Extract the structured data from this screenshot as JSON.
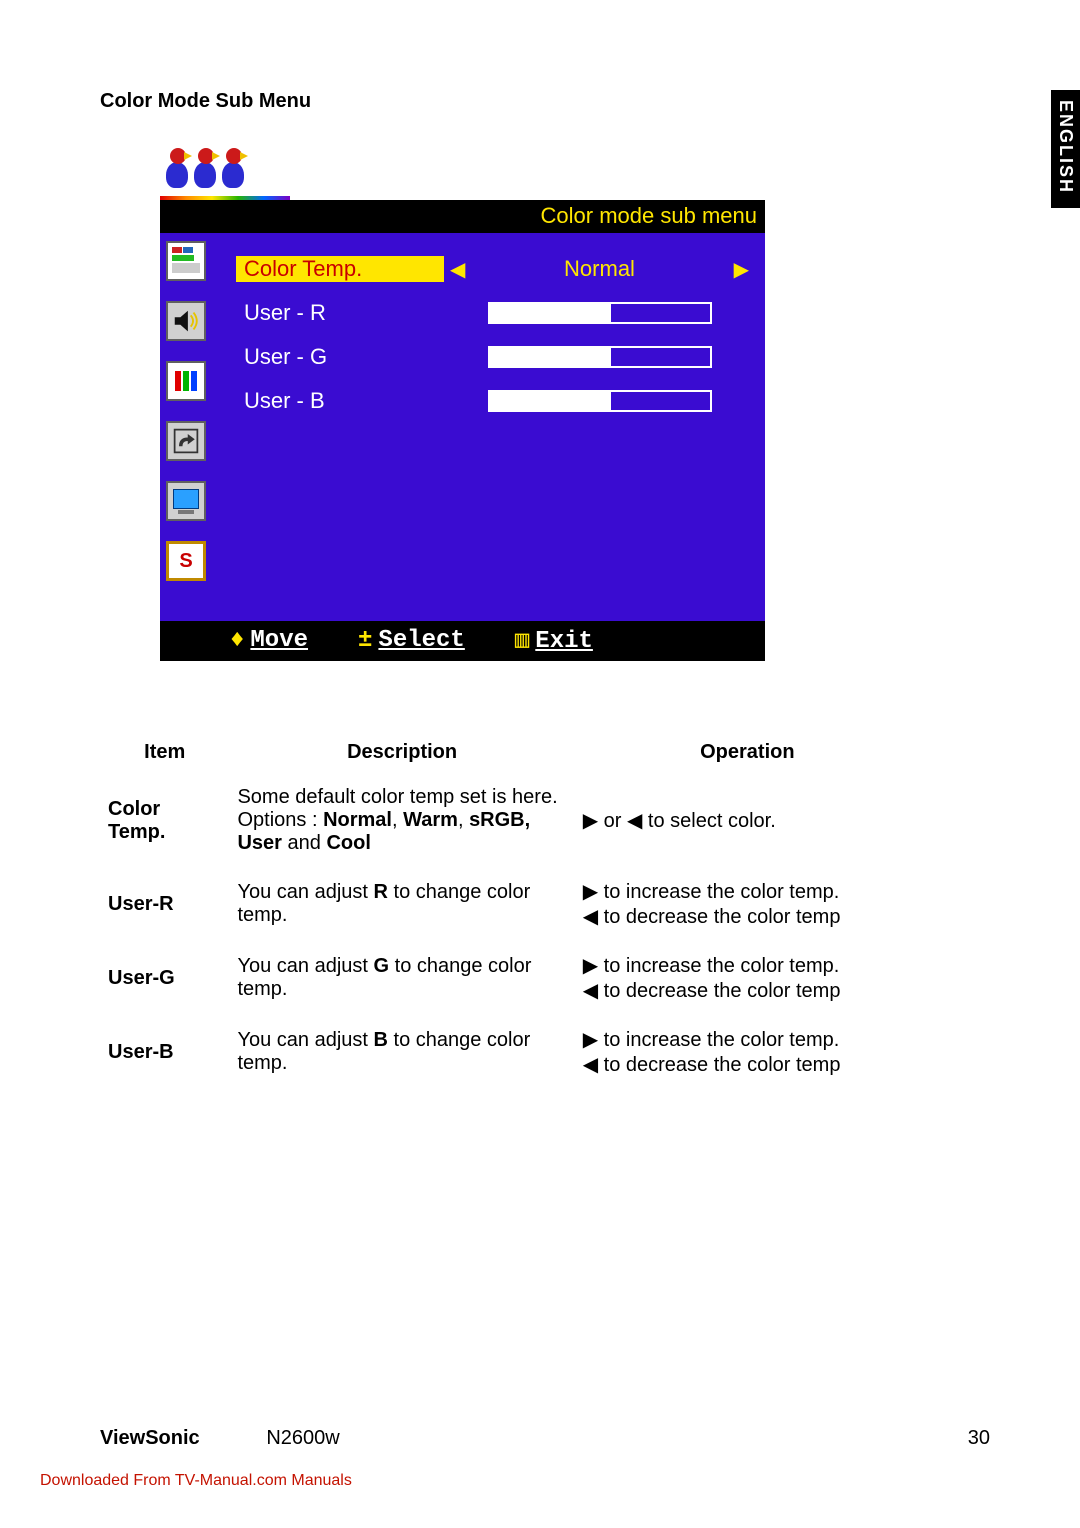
{
  "language_tab": "ENGLISH",
  "section_title": "Color Mode Sub Menu",
  "osd": {
    "title": "Color mode sub menu",
    "rows": {
      "color_temp": {
        "label": "Color Temp.",
        "value": "Normal"
      },
      "user_r": {
        "label": "User - R"
      },
      "user_g": {
        "label": "User - G"
      },
      "user_b": {
        "label": "User - B"
      }
    },
    "footer": {
      "move": "Move",
      "select": "Select",
      "exit": "Exit"
    }
  },
  "table": {
    "headers": {
      "item": "Item",
      "description": "Description",
      "operation": "Operation"
    },
    "rows": [
      {
        "item": "Color Temp.",
        "desc_pre": "Some default color temp set is here. Options : ",
        "desc_bold1": "Normal",
        "desc_sep1": ", ",
        "desc_bold2": "Warm",
        "desc_sep2": ", ",
        "desc_bold3": "sRGB, User",
        "desc_sep3": " and ",
        "desc_bold4": "Cool",
        "op": "▶ or ◀ to select color."
      },
      {
        "item": "User-R",
        "desc_pre": "You can adjust ",
        "desc_bold1": "R",
        "desc_post": " to change color temp.",
        "op_line1": "▶ to increase the color temp.",
        "op_line2": "◀ to decrease the color temp"
      },
      {
        "item": "User-G",
        "desc_pre": "You can adjust ",
        "desc_bold1": "G",
        "desc_post": " to change color temp.",
        "op_line1": "▶ to increase the color temp.",
        "op_line2": "◀ to decrease the color temp"
      },
      {
        "item": "User-B",
        "desc_pre": "You can adjust ",
        "desc_bold1": "B",
        "desc_post": " to change color temp.",
        "op_line1": "▶ to increase the color temp.",
        "op_line2": "◀ to decrease the color temp"
      }
    ]
  },
  "footer": {
    "brand": "ViewSonic",
    "model": "N2600w",
    "page": "30"
  },
  "download_link": "Downloaded From TV-Manual.com Manuals"
}
